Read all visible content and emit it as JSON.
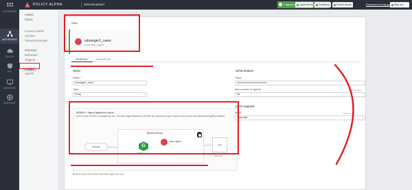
{
  "brand": {
    "name": "POLICY ALPHA"
  },
  "environment": {
    "switcher": "SOHAN-primer"
  },
  "status_banner": "1 agents successfully re-named",
  "toolbar": {
    "buttons": [
      "Latest News",
      "Feedback",
      "Publish",
      "Sign out"
    ],
    "link": "Download security guide"
  },
  "rail": [
    {
      "label": "OVERVIEW",
      "icon": "grid-icon"
    },
    {
      "label": "NETWORKS",
      "icon": "network-icon",
      "active": true
    },
    {
      "label": "CLOUD",
      "icon": "cloud-icon"
    },
    {
      "label": "IPS",
      "icon": "shield-icon"
    },
    {
      "label": "MONITOR",
      "icon": "monitor-icon"
    },
    {
      "label": "SUPPORT",
      "icon": "support-icon"
    }
  ],
  "nav": {
    "group1": [
      "Assets",
      "Zones"
    ],
    "group2": [
      "Access Control",
      "All rules",
      "Threat Prevention"
    ],
    "group3": [
      "Practices",
      "Behaviors",
      "Triggers"
    ],
    "group4_selected": "Profiles",
    "group4_next": "Agents"
  },
  "page": {
    "back": "← Back",
    "entity_name": "sdvanger1_nano",
    "entity_type": "Linux Nano Agent",
    "tabs": [
      "GENERAL",
      "ADVANCED"
    ],
    "name_section": "Name",
    "name_label": "Name *",
    "name_value": "sdvanger1_nano",
    "type_label": "Type",
    "type_value": "Proxy",
    "mode_title": "NGINX + Nano Agent for Linux",
    "mode_desc": "In this mode, NGINX is managed by you. The Nano Agent attaches to NGINX as a dynamic plug-in module and provides all CloudGuard AppSec features.",
    "diagram": {
      "source": "Internet",
      "proxy_title": "Reverse Proxy",
      "agent_label": "Nano Agent",
      "nginx_label": "NGINX",
      "app": "App",
      "app_sub": "Web App"
    },
    "foot_note": "Reverse proxy with NGINX and Nano Agent on Linux",
    "auth_section": "Authentication",
    "token_label": "Token",
    "token_value": "cp-•••••••••••••••••••••••••••••••",
    "max_agents_label": "Max number of agents",
    "max_agents_value": "50",
    "connected_label": "1 Connected",
    "upgrade_section": "Agent Upgrade",
    "mode_label": "Mode",
    "mode_value": "Automatic",
    "version_label": "Version 1.0.0"
  }
}
